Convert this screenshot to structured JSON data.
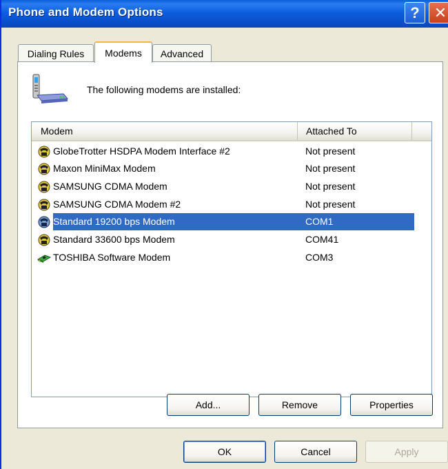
{
  "window": {
    "title": "Phone and Modem Options",
    "help_label": "?",
    "close_label": "✕"
  },
  "tabs": [
    {
      "label": "Dialing Rules",
      "active": false
    },
    {
      "label": "Modems",
      "active": true
    },
    {
      "label": "Advanced",
      "active": false
    }
  ],
  "panel": {
    "intro": "The following modems are installed:"
  },
  "list": {
    "columns": [
      "Modem",
      "Attached To"
    ],
    "rows": [
      {
        "name": "GlobeTrotter HSDPA Modem Interface #2",
        "port": "Not present",
        "icon": "modem-phone-icon"
      },
      {
        "name": "Maxon MiniMax Modem",
        "port": "Not present",
        "icon": "modem-phone-icon"
      },
      {
        "name": "SAMSUNG CDMA Modem",
        "port": "Not present",
        "icon": "modem-phone-icon"
      },
      {
        "name": "SAMSUNG CDMA Modem #2",
        "port": "Not present",
        "icon": "modem-phone-icon"
      },
      {
        "name": "Standard 19200 bps Modem",
        "port": "COM1",
        "icon": "modem-phone-icon",
        "selected": true
      },
      {
        "name": "Standard 33600 bps Modem",
        "port": "COM41",
        "icon": "modem-phone-icon"
      },
      {
        "name": "TOSHIBA Software Modem",
        "port": "COM3",
        "icon": "pci-card-icon"
      }
    ]
  },
  "buttons": {
    "add": "Add...",
    "remove": "Remove",
    "properties": "Properties",
    "ok": "OK",
    "cancel": "Cancel",
    "apply": "Apply"
  },
  "colors": {
    "titlebar": "#0a55d6",
    "selection": "#316ac5",
    "dialog_bg": "#ece9d8"
  }
}
